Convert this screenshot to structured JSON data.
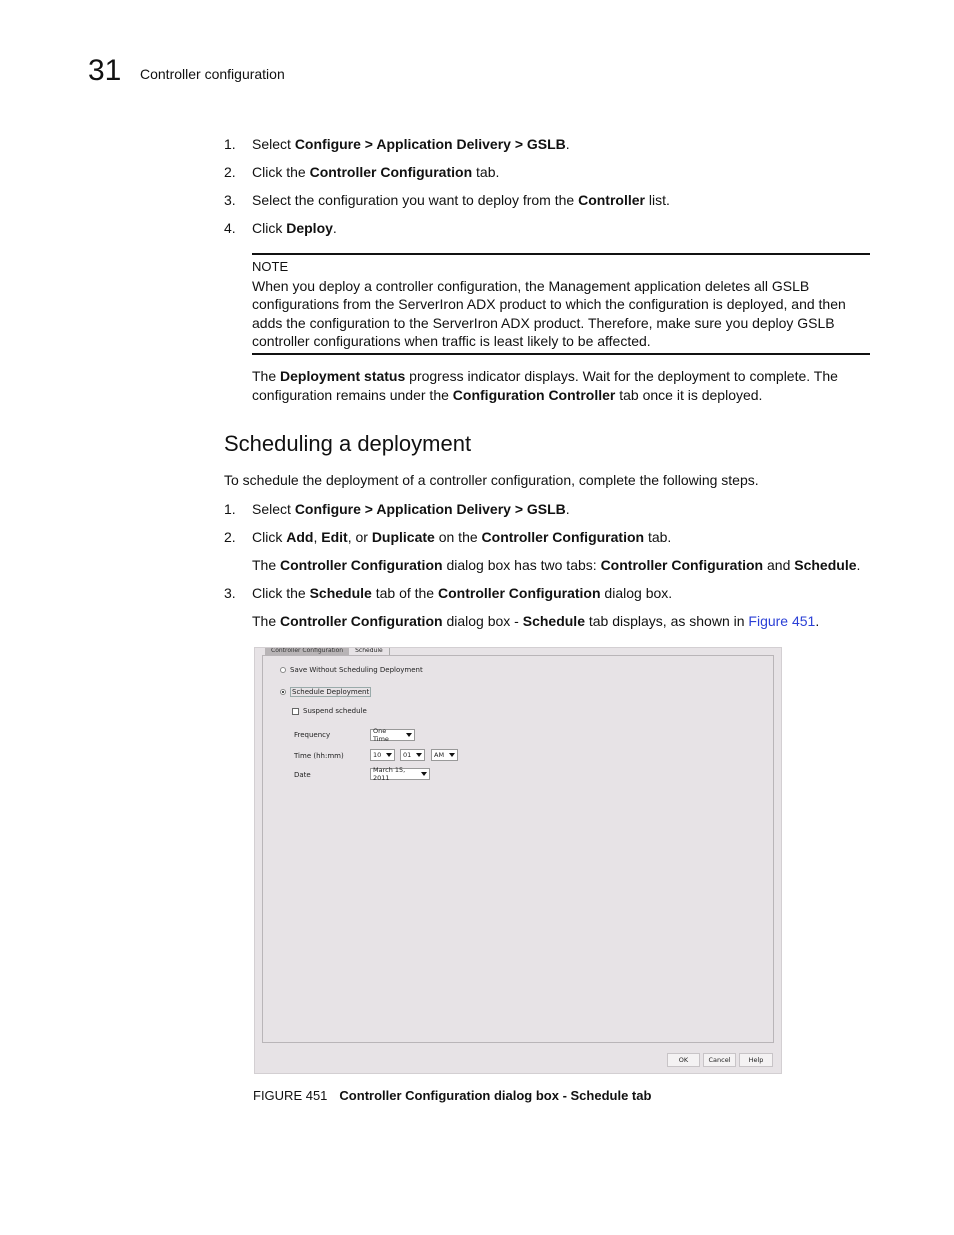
{
  "header": {
    "chapter_number": "31",
    "chapter_title": "Controller configuration"
  },
  "deploy_steps": [
    {
      "num": "1.",
      "parts": [
        {
          "t": "Select "
        },
        {
          "t": "Configure > Application Delivery > GSLB",
          "b": true
        },
        {
          "t": "."
        }
      ]
    },
    {
      "num": "2.",
      "parts": [
        {
          "t": "Click the "
        },
        {
          "t": "Controller Configuration",
          "b": true
        },
        {
          "t": " tab."
        }
      ]
    },
    {
      "num": "3.",
      "parts": [
        {
          "t": "Select the configuration you want to deploy from the "
        },
        {
          "t": "Controller",
          "b": true
        },
        {
          "t": " list."
        }
      ]
    },
    {
      "num": "4.",
      "parts": [
        {
          "t": "Click "
        },
        {
          "t": "Deploy",
          "b": true
        },
        {
          "t": "."
        }
      ]
    }
  ],
  "note": {
    "label": "NOTE",
    "text": "When you deploy a controller configuration, the Management application deletes all GSLB configurations from the ServerIron ADX product to which the configuration is deployed, and then adds the configuration to the ServerIron ADX product. Therefore, make sure you deploy GSLB controller configurations when traffic is least likely to be affected."
  },
  "deploy_status_para": [
    {
      "t": "The "
    },
    {
      "t": "Deployment status",
      "b": true
    },
    {
      "t": " progress indicator displays. Wait for the deployment to complete. The configuration remains under the "
    },
    {
      "t": "Configuration Controller",
      "b": true
    },
    {
      "t": " tab once it is deployed."
    }
  ],
  "section": {
    "heading": "Scheduling a deployment",
    "intro": "To schedule the deployment of a controller configuration, complete the following steps."
  },
  "schedule_steps": [
    {
      "num": "1.",
      "parts": [
        {
          "t": "Select "
        },
        {
          "t": "Configure > Application Delivery > GSLB",
          "b": true
        },
        {
          "t": "."
        }
      ]
    },
    {
      "num": "2.",
      "parts": [
        {
          "t": "Click "
        },
        {
          "t": "Add",
          "b": true
        },
        {
          "t": ", "
        },
        {
          "t": "Edit",
          "b": true
        },
        {
          "t": ", or "
        },
        {
          "t": "Duplicate",
          "b": true
        },
        {
          "t": " on the "
        },
        {
          "t": "Controller Configuration",
          "b": true
        },
        {
          "t": " tab."
        }
      ],
      "sub": [
        {
          "t": "The "
        },
        {
          "t": "Controller Configuration",
          "b": true
        },
        {
          "t": " dialog box has two tabs: "
        },
        {
          "t": "Controller Configuration",
          "b": true
        },
        {
          "t": " and "
        },
        {
          "t": "Schedule",
          "b": true
        },
        {
          "t": "."
        }
      ]
    },
    {
      "num": "3.",
      "parts": [
        {
          "t": "Click the "
        },
        {
          "t": "Schedule",
          "b": true
        },
        {
          "t": " tab of the "
        },
        {
          "t": "Controller Configuration",
          "b": true
        },
        {
          "t": " dialog box."
        }
      ],
      "sub": [
        {
          "t": "The "
        },
        {
          "t": "Controller Configuration",
          "b": true
        },
        {
          "t": " dialog box - "
        },
        {
          "t": "Schedule",
          "b": true
        },
        {
          "t": " tab displays, as shown in "
        },
        {
          "t": "Figure 451",
          "link": true
        },
        {
          "t": "."
        }
      ]
    }
  ],
  "dialog": {
    "tabs": [
      "Controller Configuration",
      "Schedule"
    ],
    "active_tab": "Schedule",
    "save_without_label": "Save Without Scheduling Deployment",
    "schedule_label": "Schedule Deployment",
    "schedule_selected": true,
    "suspend_label": "Suspend schedule",
    "suspend_checked": false,
    "frequency_label": "Frequency",
    "frequency_value": "One Time",
    "time_label": "Time (hh:mm)",
    "time_hour": "10",
    "time_minute": "01",
    "time_ampm": "AM",
    "date_label": "Date",
    "date_value": "March 15, 2011",
    "ok_label": "OK",
    "cancel_label": "Cancel",
    "help_label": "Help"
  },
  "figure": {
    "number": "FIGURE 451",
    "caption": "Controller Configuration dialog box - Schedule tab"
  },
  "colors": {
    "link": "#2a3fd6",
    "dialog_bg": "#e7e3e6"
  }
}
